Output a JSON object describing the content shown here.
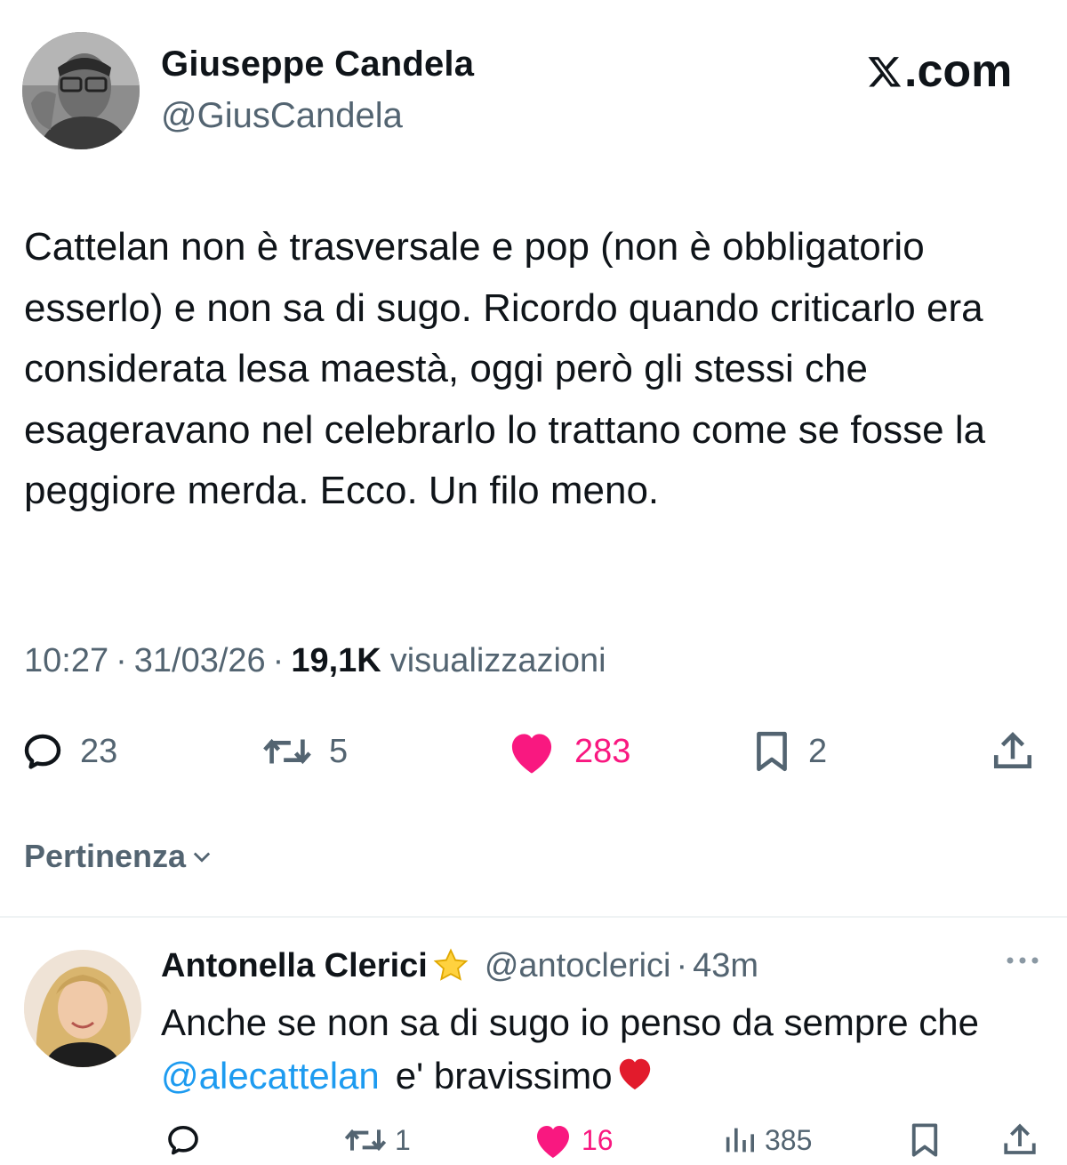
{
  "tweet": {
    "author_name": "Giuseppe Candela",
    "author_handle": "@GiusCandela",
    "brand": ".com",
    "text": "Cattelan non è trasversale e pop (non è obbligatorio esserlo) e non sa di sugo. Ricordo quando criticarlo era considerata lesa maestà, oggi però gli stessi che esageravano nel celebrarlo lo trattano come se fosse la peggiore merda. Ecco. Un filo meno.",
    "time": "10:27",
    "separator": "·",
    "date": "31/03/26",
    "views_count": "19,1K",
    "views_label": "visualizzazioni",
    "actions": {
      "replies": "23",
      "reposts": "5",
      "likes": "283",
      "bookmarks": "2"
    },
    "like_color": "#f91880"
  },
  "sort": {
    "label": "Pertinenza"
  },
  "reply": {
    "author_name": "Antonella Clerici",
    "author_handle": "@antoclerici",
    "separator": "·",
    "time": "43m",
    "text_before": "Anche se non sa di sugo io penso da sempre che",
    "mention": "@alecattelan",
    "text_after": "e' bravissimo",
    "mention_color": "#1d9bf0",
    "actions": {
      "reposts": "1",
      "likes": "16",
      "views": "385"
    }
  },
  "icons": [
    "x-logo-icon",
    "reply-icon",
    "repost-icon",
    "heart-icon",
    "bookmark-icon",
    "share-icon",
    "chevron-down-icon",
    "star-icon",
    "more-icon",
    "views-icon",
    "red-heart-emoji-icon"
  ]
}
